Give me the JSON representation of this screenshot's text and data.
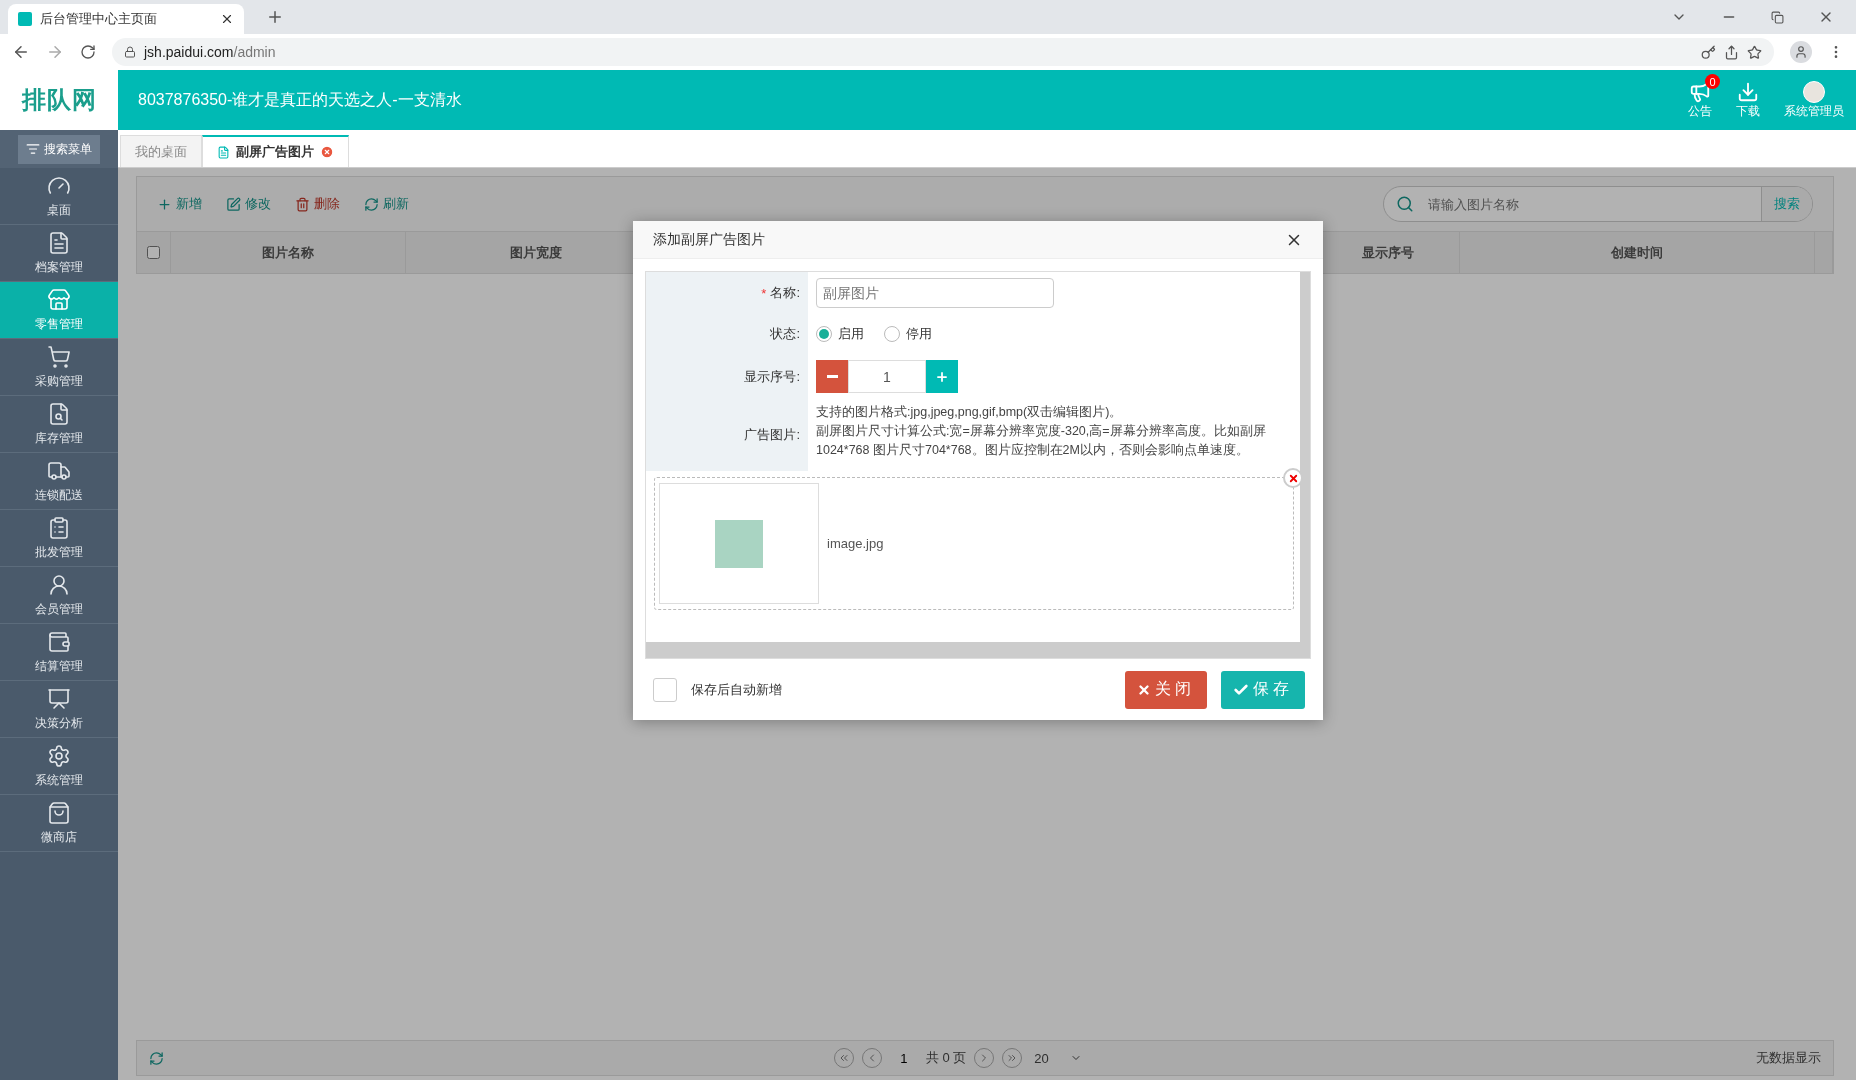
{
  "browser": {
    "tab_title": "后台管理中心主页面",
    "url_host": "jsh.paidui.com",
    "url_path": "/admin"
  },
  "header": {
    "logo": "排队网",
    "title": "8037876350-谁才是真正的天选之人-一支清水",
    "notice_count": "0",
    "notice_label": "公告",
    "download_label": "下载",
    "user": "系统管理员"
  },
  "search_menu": "搜索菜单",
  "sidebar": {
    "items": [
      {
        "label": "桌面",
        "selected": false
      },
      {
        "label": "档案管理",
        "selected": false
      },
      {
        "label": "零售管理",
        "selected": true
      },
      {
        "label": "采购管理",
        "selected": false
      },
      {
        "label": "库存管理",
        "selected": false
      },
      {
        "label": "连锁配送",
        "selected": false
      },
      {
        "label": "批发管理",
        "selected": false
      },
      {
        "label": "会员管理",
        "selected": false
      },
      {
        "label": "结算管理",
        "selected": false
      },
      {
        "label": "决策分析",
        "selected": false
      },
      {
        "label": "系统管理",
        "selected": false
      },
      {
        "label": "微商店",
        "selected": false
      }
    ]
  },
  "tabs": [
    {
      "label": "我的桌面",
      "selected": false,
      "closable": false
    },
    {
      "label": "副屏广告图片",
      "selected": true,
      "closable": true
    }
  ],
  "toolbar": {
    "buttons": [
      {
        "label": "新增",
        "kind": "add"
      },
      {
        "label": "修改",
        "kind": "edit"
      },
      {
        "label": "删除",
        "kind": "delete"
      },
      {
        "label": "刷新",
        "kind": "refresh"
      }
    ],
    "search_placeholder": "请输入图片名称",
    "search_button": "搜索"
  },
  "table": {
    "columns_left": [
      "图片名称",
      "图片宽度"
    ],
    "columns_right": [
      "显示序号",
      "创建时间"
    ],
    "select_all": false
  },
  "pager": {
    "page": "1",
    "total": "共 0 页",
    "page_size": "20",
    "status": "无数据显示"
  },
  "dialog": {
    "title": "添加副屏广告图片",
    "name": {
      "label": "名称:",
      "required_mark": "*",
      "placeholder": "副屏图片"
    },
    "status": {
      "label": "状态:",
      "options": [
        {
          "label": "启用",
          "selected": true
        },
        {
          "label": "停用",
          "selected": false
        }
      ]
    },
    "order": {
      "label": "显示序号:",
      "value": "1"
    },
    "image": {
      "label": "广告图片:",
      "hint": [
        "支持的图片格式:jpg,jpeg,png,gif,bmp(双击编辑图片)。",
        "副屏图片尺寸计算公式:宽=屏幕分辨率宽度-320,高=屏幕分辨率高度。比如副屏1024*768 图片尺寸704*768。图片应控制在2M以内，否则会影响点单速度。"
      ],
      "file_name": "image.jpg"
    },
    "auto_add": {
      "label": "保存后自动新增",
      "checked": false
    },
    "close_button": "关闭",
    "save_button": "保存"
  }
}
